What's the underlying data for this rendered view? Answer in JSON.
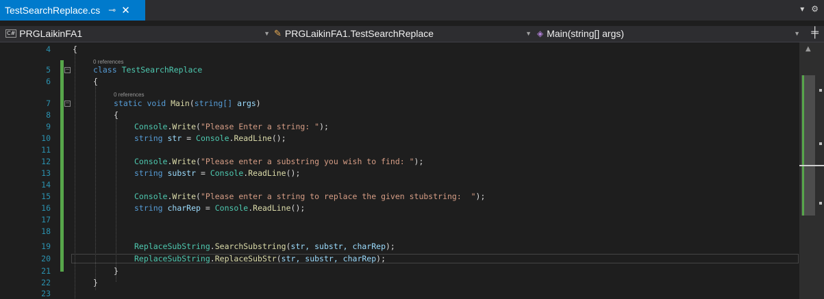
{
  "tab": {
    "title": "TestSearchReplace.cs",
    "pin_glyph": "⊸",
    "close_glyph": "✕"
  },
  "tabstrip_right": {
    "dropdown_glyph": "▾",
    "settings_glyph": "⚙"
  },
  "navbar": {
    "project_badge": "C#",
    "project": "PRGLaikinFA1",
    "type": "PRGLaikinFA1.TestSearchReplace",
    "member": "Main(string[] args)",
    "split_glyph": "╪"
  },
  "lens": {
    "references": "0 references"
  },
  "lines": {
    "n4": "4",
    "n5": "5",
    "n6": "6",
    "n7": "7",
    "n8": "8",
    "n9": "9",
    "n10": "10",
    "n11": "11",
    "n12": "12",
    "n13": "13",
    "n14": "14",
    "n15": "15",
    "n16": "16",
    "n17": "17",
    "n18": "18",
    "n19": "19",
    "n20": "20",
    "n21": "21",
    "n22": "22",
    "n23": "23"
  },
  "code": {
    "open_brace": "{",
    "close_brace": "}",
    "kw_class": "class",
    "class_name": "TestSearchReplace",
    "kw_static": "static",
    "kw_void": "void",
    "main_name": "Main",
    "main_params_open": "(",
    "kw_string_arr": "string[]",
    "args": "args",
    "main_params_close": ")",
    "console": "Console",
    "dot": ".",
    "write": "Write",
    "readline": "ReadLine",
    "kw_string": "string",
    "l9_str": "\"Please Enter a string: \"",
    "l12_str": "\"Please enter a substring you wish to find: \"",
    "l15_str": "\"Please enter a string to replace the given stubstring:  \"",
    "var_str": "str",
    "var_substr": "substr",
    "var_charRep": "charRep",
    "assign": " = ",
    "call_end": "();",
    "paren_open": "(",
    "paren_close_semi": ");",
    "replace_class": "ReplaceSubString",
    "search_method": "SearchSubstring",
    "replace_method": "ReplaceSubStr",
    "args3": "str, substr, charRep"
  }
}
